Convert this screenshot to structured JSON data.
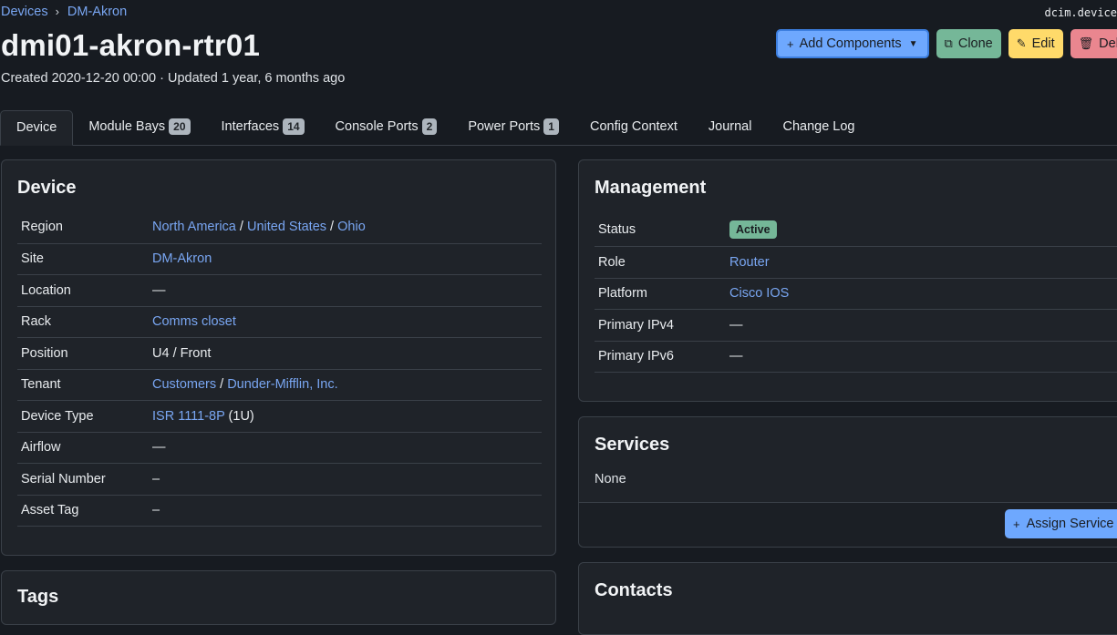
{
  "breadcrumb": {
    "root": "Devices",
    "site": "DM-Akron"
  },
  "object_id": "dcim.device",
  "title": "dmi01-akron-rtr01",
  "meta": {
    "created": "Created 2020-12-20 00:00",
    "separator": " · ",
    "updated": "Updated 1 year, 6 months ago"
  },
  "actions": {
    "add_components": "Add Components",
    "clone": "Clone",
    "edit": "Edit",
    "delete": "Delete"
  },
  "tabs": [
    {
      "label": "Device",
      "badge": null
    },
    {
      "label": "Module Bays",
      "badge": "20"
    },
    {
      "label": "Interfaces",
      "badge": "14"
    },
    {
      "label": "Console Ports",
      "badge": "2"
    },
    {
      "label": "Power Ports",
      "badge": "1"
    },
    {
      "label": "Config Context",
      "badge": null
    },
    {
      "label": "Journal",
      "badge": null
    },
    {
      "label": "Change Log",
      "badge": null
    }
  ],
  "device_card": {
    "title": "Device",
    "rows": {
      "region": {
        "label": "Region",
        "v1": "North America",
        "sep": " / ",
        "v2": "United States",
        "sep2": " / ",
        "v3": "Ohio"
      },
      "site": {
        "label": "Site",
        "value": "DM-Akron"
      },
      "location": {
        "label": "Location",
        "value": "—"
      },
      "rack": {
        "label": "Rack",
        "value": "Comms closet"
      },
      "position": {
        "label": "Position",
        "value": "U4 / Front"
      },
      "tenant": {
        "label": "Tenant",
        "v1": "Customers",
        "sep": " / ",
        "v2": "Dunder-Mifflin, Inc."
      },
      "device_type": {
        "label": "Device Type",
        "value": "ISR 1111-8P",
        "suffix": " (1U)"
      },
      "airflow": {
        "label": "Airflow",
        "value": "—"
      },
      "serial": {
        "label": "Serial Number",
        "value": "–"
      },
      "asset_tag": {
        "label": "Asset Tag",
        "value": "–"
      }
    }
  },
  "management_card": {
    "title": "Management",
    "rows": {
      "status": {
        "label": "Status",
        "value": "Active"
      },
      "role": {
        "label": "Role",
        "value": "Router"
      },
      "platform": {
        "label": "Platform",
        "value": "Cisco IOS"
      },
      "ipv4": {
        "label": "Primary IPv4",
        "value": "—"
      },
      "ipv6": {
        "label": "Primary IPv6",
        "value": "—"
      }
    }
  },
  "services_card": {
    "title": "Services",
    "empty": "None",
    "assign": "Assign Service"
  },
  "tags_card": {
    "title": "Tags"
  },
  "contacts_card": {
    "title": "Contacts"
  },
  "colors": {
    "background": "#171b21",
    "card": "#1f2329",
    "link": "#79a6f2",
    "primary": "#6ea8fe",
    "success": "#75b798",
    "warning": "#ffda6a",
    "danger": "#ea868f"
  }
}
